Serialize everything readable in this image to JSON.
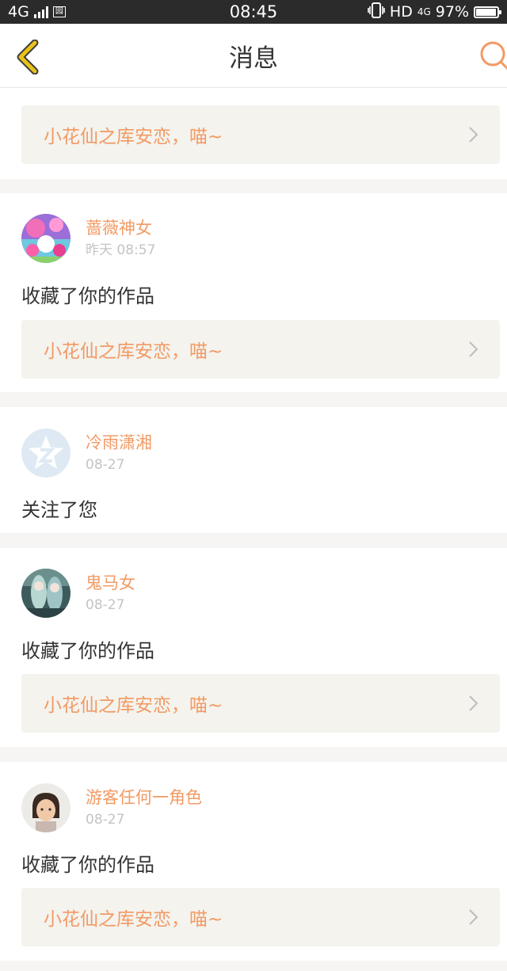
{
  "status_bar": {
    "network": "4G",
    "sim_label": "园",
    "time": "08:45",
    "hd_label": "HD",
    "data_label": "4G",
    "battery": "97%",
    "battery_level": 0.97
  },
  "header": {
    "title": "消息"
  },
  "messages": [
    {
      "type": "work",
      "work_title": "小花仙之库安恋，喵~"
    },
    {
      "type": "favorite",
      "user": "蔷薇神女",
      "time": "昨天 08:57",
      "action": "收藏了你的作品",
      "work_title": "小花仙之库安恋，喵~"
    },
    {
      "type": "follow",
      "user": "冷雨潇湘",
      "time": "08-27",
      "action": "关注了您"
    },
    {
      "type": "favorite",
      "user": "鬼马女",
      "time": "08-27",
      "action": "收藏了你的作品",
      "work_title": "小花仙之库安恋，喵~"
    },
    {
      "type": "favorite",
      "user": "游客任何一角色",
      "time": "08-27",
      "action": "收藏了你的作品",
      "work_title": "小花仙之库安恋，喵~"
    }
  ],
  "colors": {
    "accent": "#f29a64",
    "back_icon": "#e8c21a",
    "link_bg": "#f4f3ee",
    "page_bg": "#f7f5f3"
  },
  "icons": [
    "back-chevron-icon",
    "search-icon",
    "chevron-right-icon"
  ]
}
